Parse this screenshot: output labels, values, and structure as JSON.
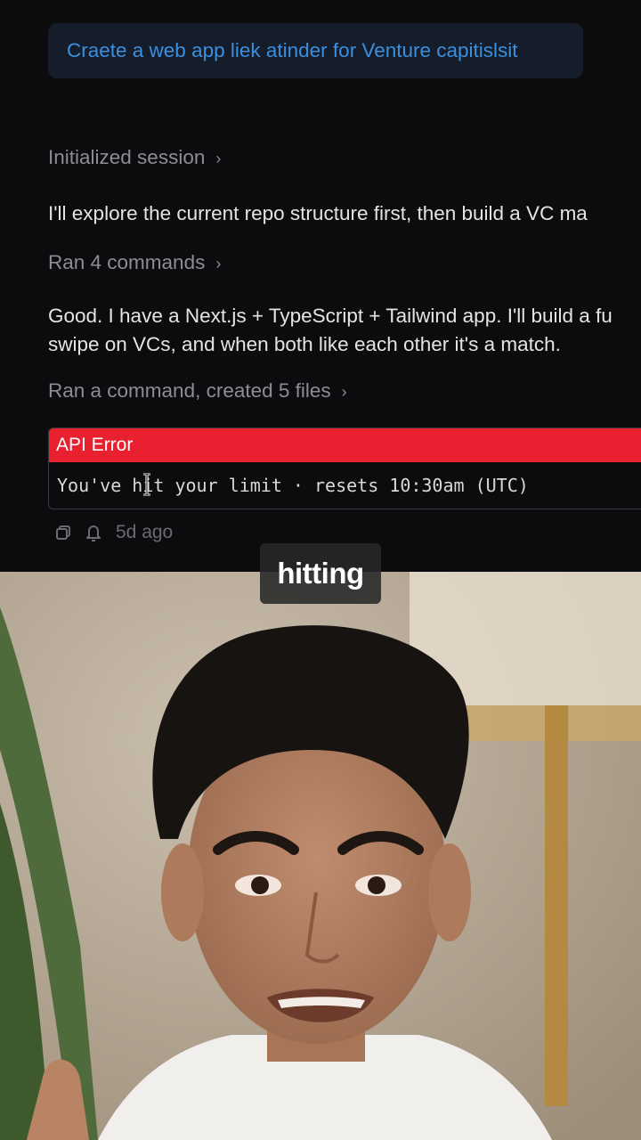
{
  "chat": {
    "user_prompt": "Craete a web app liek atinder for Venture capitislsit",
    "steps": [
      {
        "label": "Initialized session",
        "chevron": "chevron-right-icon"
      },
      {
        "text": "I'll explore the current repo structure first, then build a VC ma"
      },
      {
        "label": "Ran 4 commands",
        "chevron": "chevron-right-icon"
      },
      {
        "text_line1": "Good. I have a Next.js + TypeScript + Tailwind app. I'll build a fu",
        "text_line2": "swipe on VCs, and when both like each other it's a match."
      },
      {
        "label": "Ran a command, created 5 files",
        "chevron": "chevron-right-icon"
      }
    ],
    "error": {
      "title": "API Error",
      "message": "You've hit your limit · resets 10:30am (UTC)"
    },
    "meta": {
      "icons": [
        "copy-icon",
        "bell-icon"
      ],
      "timestamp": "5d ago"
    }
  },
  "video": {
    "caption": "hitting"
  },
  "colors": {
    "background": "#0c0c0e",
    "prompt_text": "#3a8fe0",
    "error_header": "#e8202f"
  }
}
